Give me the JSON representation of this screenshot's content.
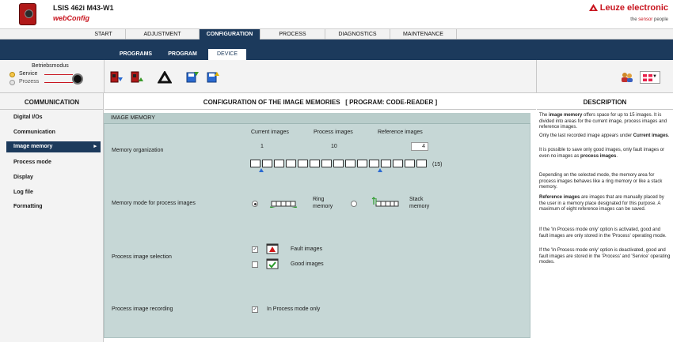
{
  "header": {
    "device_name": "LSIS 462i M43-W1",
    "app_name": "webConfig",
    "brand": "Leuze electronic",
    "brand_tag_prefix": "the ",
    "brand_tag_accent": "sensor",
    "brand_tag_suffix": " people"
  },
  "main_nav": {
    "tabs": [
      "START",
      "ADJUSTMENT",
      "CONFIGURATION",
      "PROCESS",
      "DIAGNOSTICS",
      "MAINTENANCE"
    ],
    "active": "CONFIGURATION"
  },
  "sub_nav": {
    "tabs": [
      "PROGRAMS",
      "PROGRAM",
      "DEVICE"
    ],
    "active": "DEVICE"
  },
  "mode": {
    "title": "Betriebsmodus",
    "service_label": "Service",
    "process_label": "Prozess"
  },
  "icons": {
    "toolbar": [
      "download-from-device-icon",
      "upload-to-device-icon",
      "recycle-icon",
      "save-to-pc-icon",
      "load-from-pc-icon"
    ],
    "right": [
      "users-icon",
      "language-flag-icon"
    ]
  },
  "sidebar": {
    "title": "COMMUNICATION",
    "items": [
      "Digital I/Os",
      "Communication",
      "Image memory",
      "Process mode",
      "Display",
      "Log file",
      "Formatting"
    ],
    "active": "Image memory"
  },
  "content": {
    "title": "CONFIGURATION OF THE IMAGE MEMORIES   [ PROGRAM: CODE-READER ]",
    "panel_title": "IMAGE MEMORY",
    "memory_org": {
      "label": "Memory organization",
      "col_current": "Current images",
      "col_process": "Process images",
      "col_reference": "Reference images",
      "current_value": "1",
      "process_value": "10",
      "reference_value": "4",
      "total_label": "(15)",
      "total_cells": 15
    },
    "memory_mode": {
      "label": "Memory mode for process images",
      "ring_line1": "Ring",
      "ring_line2": "memory",
      "stack_line1": "Stack",
      "stack_line2": "memory",
      "selected": "ring"
    },
    "image_selection": {
      "label": "Process image selection",
      "fault_label": "Fault images",
      "fault_checked": true,
      "good_label": "Good images",
      "good_checked": false
    },
    "recording": {
      "label": "Process image recording",
      "option_label": "In Process mode only",
      "checked": true
    }
  },
  "description": {
    "title": "DESCRIPTION",
    "p1_pre": "The ",
    "p1_bold": "image memory",
    "p1_post": " offers space for up to 15 images. It is divided into areas for the current image, process images and reference images.",
    "p2_pre": "Only the last recorded image appears under ",
    "p2_bold": "Current images",
    "p2_post": ".",
    "p3_pre": "It is possible to save only good images, only fault images or even no images as ",
    "p3_bold": "process images",
    "p3_post": ".",
    "p4": "Depending on the selected mode, the memory area for process images behaves like a ring memory or like a stack memory.",
    "p5_bold": "Reference images",
    "p5_post": " are images that are manually placed by the user in a memory place designated for this purpose. A maximum of eight reference images can be saved.",
    "p6": "If the 'In Process mode only' option is activated, good and fault images are only stored in the 'Process' operating mode.",
    "p7": "If the 'In Process mode only' option is deactivated, good and fault images are stored in the 'Process' and 'Service' operating modes."
  },
  "colors": {
    "brand_red": "#c8141e",
    "nav_blue": "#1c3a5c",
    "panel_bg": "#c6d7d6"
  }
}
